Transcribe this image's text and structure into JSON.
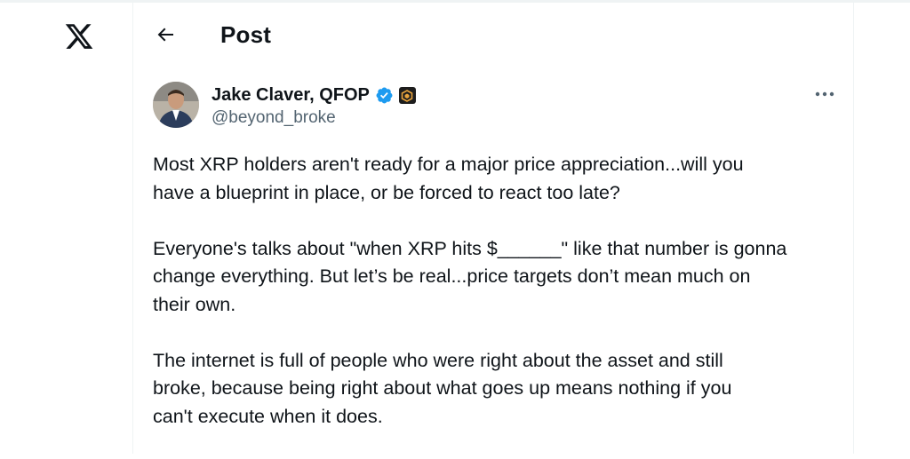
{
  "header": {
    "title": "Post"
  },
  "author": {
    "display_name": "Jake Claver, QFOP",
    "handle": "@beyond_broke"
  },
  "tweet": {
    "paragraphs": [
      "Most XRP holders aren't ready for a major price appreciation...will you\nhave a blueprint in place, or be forced to react too late?",
      "Everyone's talks about \"when XRP hits $______\" like that number is gonna\nchange everything. But let’s be real...price targets don’t mean much on\ntheir own.",
      "The internet is full of people who were right about the asset and still\nbroke, because being right about what goes up means nothing if you\ncan't execute when it does."
    ]
  },
  "colors": {
    "verified": "#1d9bf0",
    "secondary_text": "#536471",
    "primary_text": "#0f1419"
  },
  "icons": {
    "logo": "x-logo-icon",
    "back": "back-arrow-icon",
    "verified": "verified-badge-icon",
    "affiliate": "affiliate-badge-icon",
    "more": "more-options-icon"
  }
}
